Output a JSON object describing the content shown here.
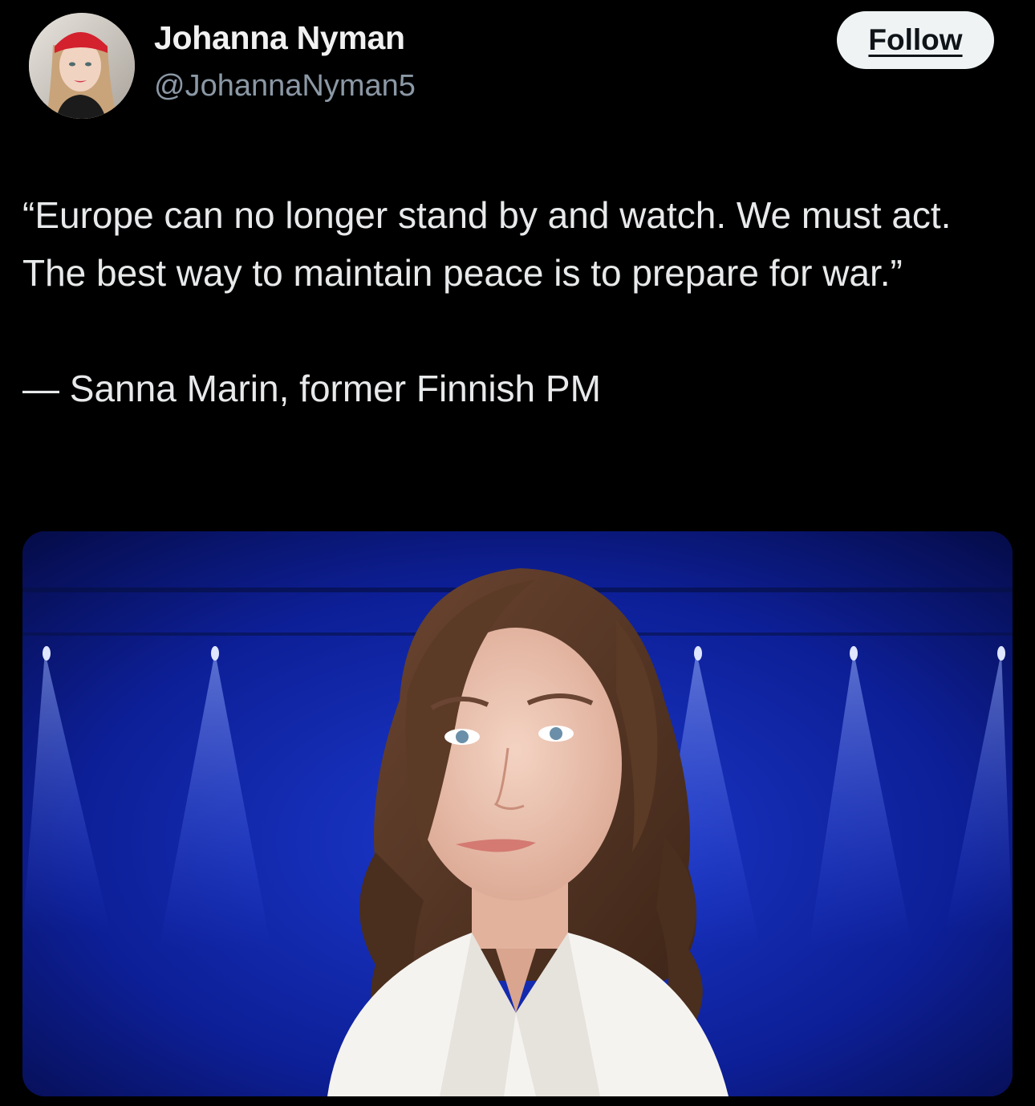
{
  "author": {
    "display_name": "Johanna Nyman",
    "handle": "@JohannaNyman5",
    "avatar_icon": "profile-photo"
  },
  "follow_button": {
    "label": "Follow"
  },
  "tweet": {
    "quote": "“Europe can no longer stand by and watch. We must act. The best way to maintain peace is to prepare for war.”",
    "attribution": "— Sanna Marin, former Finnish PM"
  },
  "media": {
    "type": "photo",
    "background_color": "#0b1a86",
    "jacket_color": "#f5f3f0",
    "hair_color": "#5a3a28"
  },
  "colors": {
    "background": "#000000",
    "text": "#e7e9ea",
    "muted": "#8b98a5",
    "button_bg": "#eff3f4"
  }
}
